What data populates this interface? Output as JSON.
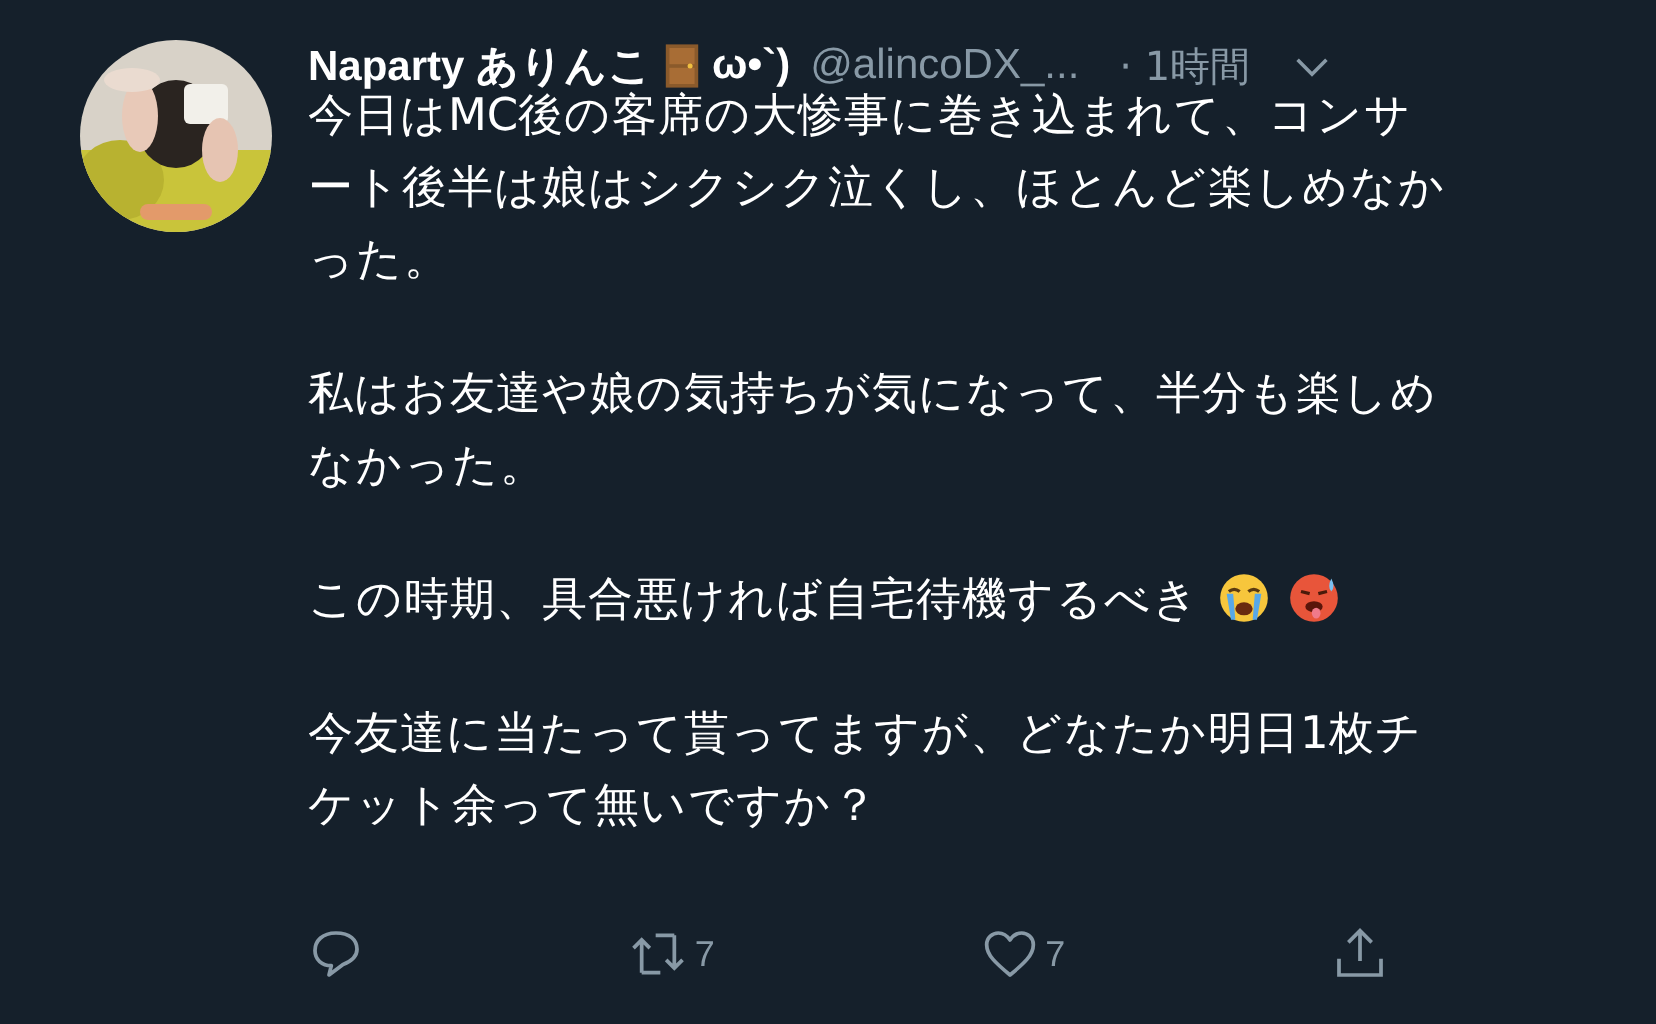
{
  "tweet": {
    "name": "Naparty ありんこ",
    "name_suffix": "ω•`)",
    "handle": "@alincoDX_...",
    "time": "· 1時間",
    "paragraphs": [
      {
        "text": "今日はMC後の客席の大惨事に巻き込まれて、コンサート後半は娘はシクシク泣くし、ほとんど楽しめなかった。",
        "emoji": false
      },
      {
        "text": "私はお友達や娘の気持ちが気になって、半分も楽しめなかった。",
        "emoji": false
      },
      {
        "text": "この時期、具合悪ければ自宅待機するべき",
        "emoji": true
      },
      {
        "text": "今友達に当たって貰ってますが、どなたか明日1枚チケット余って無いですか？",
        "emoji": false
      }
    ],
    "actions": [
      {
        "kind": "reply"
      },
      {
        "kind": "retweet",
        "count": "7"
      },
      {
        "kind": "like",
        "count": "7"
      },
      {
        "kind": "share"
      }
    ]
  }
}
